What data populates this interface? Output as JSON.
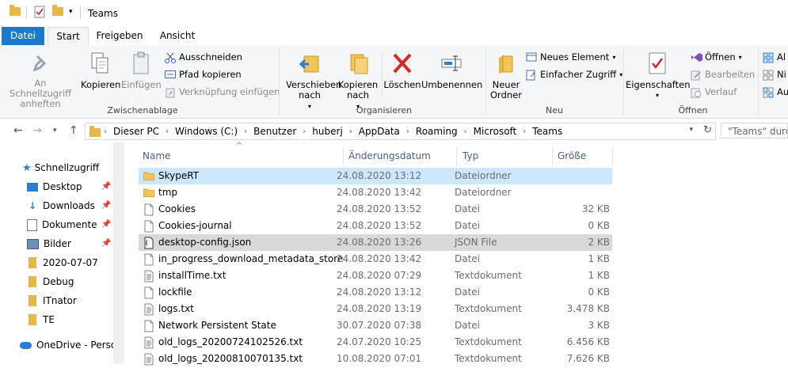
{
  "window": {
    "title": "Teams"
  },
  "tabs": [
    {
      "label": "Datei"
    },
    {
      "label": "Start"
    },
    {
      "label": "Freigeben"
    },
    {
      "label": "Ansicht"
    }
  ],
  "ribbon": {
    "clipboard": {
      "label": "Zwischenablage",
      "pin": "An Schnellzugriff anheften",
      "copy": "Kopieren",
      "paste": "Einfügen",
      "cut": "Ausschneiden",
      "copy_path": "Pfad kopieren",
      "paste_shortcut": "Verknüpfung einfügen"
    },
    "organize": {
      "label": "Organisieren",
      "move_to": "Verschieben nach",
      "copy_to": "Kopieren nach",
      "delete": "Löschen",
      "rename": "Umbenennen"
    },
    "new": {
      "label": "Neu",
      "new_folder": "Neuer Ordner",
      "new_item": "Neues Element",
      "easy_access": "Einfacher Zugriff"
    },
    "open": {
      "label": "Öffnen",
      "properties": "Eigenschaften",
      "open": "Öffnen",
      "edit": "Bearbeiten",
      "history": "Verlauf"
    },
    "select": {
      "all": "Al",
      "none": "Ni",
      "invert": "Au"
    }
  },
  "address": {
    "crumbs": [
      "Dieser PC",
      "Windows (C:)",
      "Benutzer",
      "huberj",
      "AppData",
      "Roaming",
      "Microsoft",
      "Teams"
    ],
    "search_placeholder": "\"Teams\" durchsuchen"
  },
  "nav": [
    {
      "label": "Schnellzugriff",
      "icon": "star-icon",
      "pinned": false
    },
    {
      "label": "Desktop",
      "icon": "desktop-icon",
      "pinned": true
    },
    {
      "label": "Downloads",
      "icon": "download-icon",
      "pinned": true
    },
    {
      "label": "Dokumente",
      "icon": "documents-icon",
      "pinned": true
    },
    {
      "label": "Bilder",
      "icon": "pictures-icon",
      "pinned": true
    },
    {
      "label": "2020-07-07",
      "icon": "folder-icon",
      "pinned": false
    },
    {
      "label": "Debug",
      "icon": "folder-icon",
      "pinned": false
    },
    {
      "label": "ITnator",
      "icon": "folder-icon",
      "pinned": false
    },
    {
      "label": "TE",
      "icon": "folder-icon",
      "pinned": false
    },
    {
      "label": "OneDrive - Persor",
      "icon": "cloud-icon",
      "pinned": false
    }
  ],
  "columns": {
    "name": "Name",
    "date": "Änderungsdatum",
    "type": "Typ",
    "size": "Größe"
  },
  "files": [
    {
      "name": "SkypeRT",
      "date": "24.08.2020 13:12",
      "type": "Dateiordner",
      "size": "",
      "kind": "folder",
      "state": "selected"
    },
    {
      "name": "tmp",
      "date": "24.08.2020 13:42",
      "type": "Dateiordner",
      "size": "",
      "kind": "folder",
      "state": ""
    },
    {
      "name": "Cookies",
      "date": "24.08.2020 13:52",
      "type": "Datei",
      "size": "32 KB",
      "kind": "file",
      "state": ""
    },
    {
      "name": "Cookies-journal",
      "date": "24.08.2020 13:52",
      "type": "Datei",
      "size": "0 KB",
      "kind": "file",
      "state": ""
    },
    {
      "name": "desktop-config.json",
      "date": "24.08.2020 13:26",
      "type": "JSON File",
      "size": "2 KB",
      "kind": "json",
      "state": "hover"
    },
    {
      "name": "in_progress_download_metadata_store",
      "date": "24.08.2020 13:42",
      "type": "Datei",
      "size": "1 KB",
      "kind": "file",
      "state": ""
    },
    {
      "name": "installTime.txt",
      "date": "24.08.2020 07:29",
      "type": "Textdokument",
      "size": "1 KB",
      "kind": "text",
      "state": ""
    },
    {
      "name": "lockfile",
      "date": "24.08.2020 13:12",
      "type": "Datei",
      "size": "0 KB",
      "kind": "file",
      "state": ""
    },
    {
      "name": "logs.txt",
      "date": "24.08.2020 13:19",
      "type": "Textdokument",
      "size": "3.478 KB",
      "kind": "text",
      "state": ""
    },
    {
      "name": "Network Persistent State",
      "date": "30.07.2020 07:38",
      "type": "Datei",
      "size": "3 KB",
      "kind": "file",
      "state": ""
    },
    {
      "name": "old_logs_20200724102526.txt",
      "date": "24.07.2020 10:25",
      "type": "Textdokument",
      "size": "6.456 KB",
      "kind": "text",
      "state": ""
    },
    {
      "name": "old_logs_20200810070135.txt",
      "date": "10.08.2020 07:01",
      "type": "Textdokument",
      "size": "7.626 KB",
      "kind": "text",
      "state": ""
    }
  ],
  "colors": {
    "accent": "#1979ca",
    "selection": "#cce8ff",
    "hover": "#d9d9d9",
    "folder": "#e6b84a"
  }
}
